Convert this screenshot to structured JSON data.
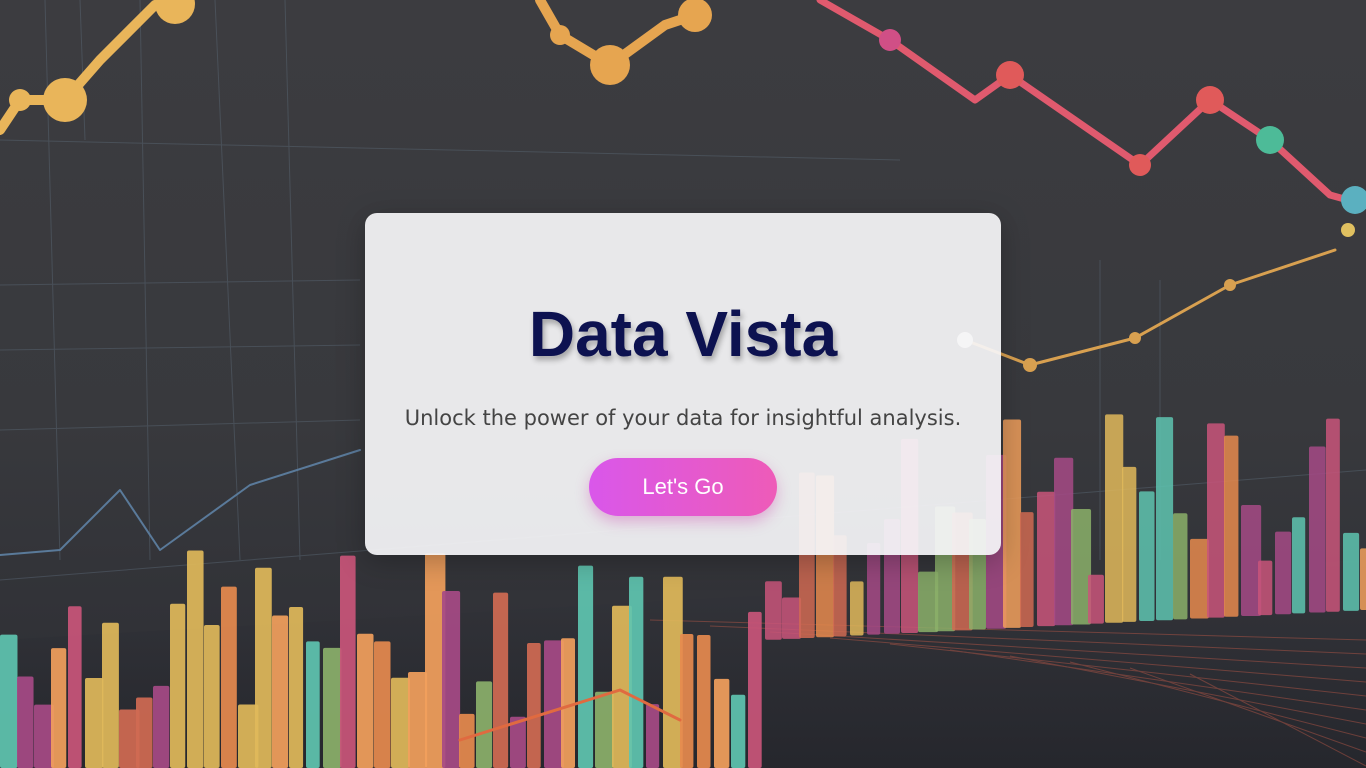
{
  "hero": {
    "title": "Data Vista",
    "subtitle": "Unlock the power of your data for insightful analysis.",
    "cta_label": "Let's Go"
  },
  "colors": {
    "title": "#0d1250",
    "button_gradient_start": "#d957ea",
    "button_gradient_end": "#ee5bb8",
    "background": "#3a3a3d"
  }
}
